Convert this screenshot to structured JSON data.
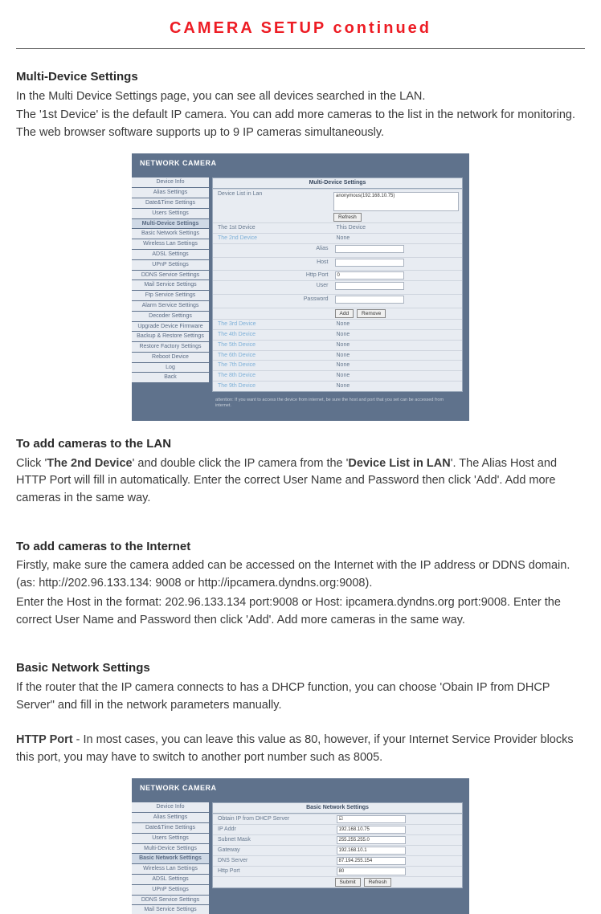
{
  "title": "CAMERA SETUP continued",
  "sections": {
    "multiDeviceHeading": "Multi-Device Settings",
    "multiDeviceP1": "In the Multi Device Settings page, you can see all devices searched in the LAN.",
    "multiDeviceP2": "The '1st Device' is the default IP camera. You can add more cameras to the list in the network for monitoring. The web browser software supports up to 9 IP cameras simultaneously.",
    "addLanHeading": "To add cameras to the LAN",
    "addLanPart1": "Click '",
    "addLanBold1": "The 2nd Device",
    "addLanPart2": "' and double click the IP camera from the '",
    "addLanBold2": "Device List in LAN",
    "addLanPart3": "'. The Alias Host and HTTP Port will fill in automatically. Enter the correct User Name and Password then click  'Add'. Add more cameras in the same way.",
    "addInternetHeading": "To add cameras to the Internet",
    "addInternetP1": "Firstly, make sure the camera added can be accessed on the Internet with the IP address or DDNS domain. (as: http://202.96.133.134: 9008 or http://ipcamera.dyndns.org:9008).",
    "addInternetP2": "Enter the Host in the format: 202.96.133.134 port:9008 or Host: ipcamera.dyndns.org port:9008. Enter the correct User Name and Password then click  'Add'. Add more cameras in the same way.",
    "basicNetHeading": "Basic Network Settings",
    "basicNetP1": "If the router that the IP camera connects to has a DHCP function, you can choose 'Obain IP from DHCP Server\" and fill in the network parameters manually.",
    "httpPortBold": "HTTP Port",
    "httpPortRest": " - In most cases, you can leave this value as 80, however, if your Internet Service Provider blocks this port, you may have to switch to another port number such as 8005."
  },
  "sidebarItems": [
    "Device Info",
    "Alias Settings",
    "Date&Time Settings",
    "Users Settings",
    "Multi-Device Settings",
    "Basic Network Settings",
    "Wireless Lan Settings",
    "ADSL Settings",
    "UPnP Settings",
    "DDNS Service Settings",
    "Mail Service Settings",
    "Ftp Service Settings",
    "Alarm Service Settings",
    "Decoder Settings",
    "Upgrade Device Firmware",
    "Backup & Restore Settings",
    "Restore Factory Settings",
    "Reboot Device",
    "Log",
    "Back"
  ],
  "shot1": {
    "banner": "NETWORK CAMERA",
    "hdMulti": "Multi-Device Settings",
    "hdList": "Device List in Lan",
    "anonymous": "anonymous(192.168.10.75)",
    "refresh": "Refresh",
    "field_alias": "Alias",
    "field_host": "Host",
    "field_httpport": "Http Port",
    "field_httpport_val": "0",
    "field_user": "User",
    "field_password": "Password",
    "btn_add": "Add",
    "btn_remove": "Remove",
    "devices": [
      {
        "label": "The 1st Device",
        "value": "This Device",
        "inactive": false
      },
      {
        "label": "The 2nd Device",
        "value": "None",
        "inactive": true
      },
      {
        "label": "The 3rd Device",
        "value": "None",
        "inactive": true
      },
      {
        "label": "The 4th Device",
        "value": "None",
        "inactive": true
      },
      {
        "label": "The 5th Device",
        "value": "None",
        "inactive": true
      },
      {
        "label": "The 6th Device",
        "value": "None",
        "inactive": true
      },
      {
        "label": "The 7th Device",
        "value": "None",
        "inactive": true
      },
      {
        "label": "The 8th Device",
        "value": "None",
        "inactive": true
      },
      {
        "label": "The 9th Device",
        "value": "None",
        "inactive": true
      }
    ],
    "footnote": "attention: If you want to access the device from internet, be sure the host and port that you set can be accessed from internet."
  },
  "shot2": {
    "banner": "NETWORK CAMERA",
    "hd": "Basic Network Settings",
    "rows": [
      {
        "label": "Obtain IP from DHCP Server",
        "value": "☑"
      },
      {
        "label": "IP Addr",
        "value": "192.168.10.75"
      },
      {
        "label": "Subnet Mask",
        "value": "255.255.255.0"
      },
      {
        "label": "Gateway",
        "value": "192.168.10.1"
      },
      {
        "label": "DNS Server",
        "value": "87.194.255.154"
      },
      {
        "label": "Http Port",
        "value": "80"
      }
    ],
    "btn_submit": "Submit",
    "btn_refresh": "Refresh"
  }
}
